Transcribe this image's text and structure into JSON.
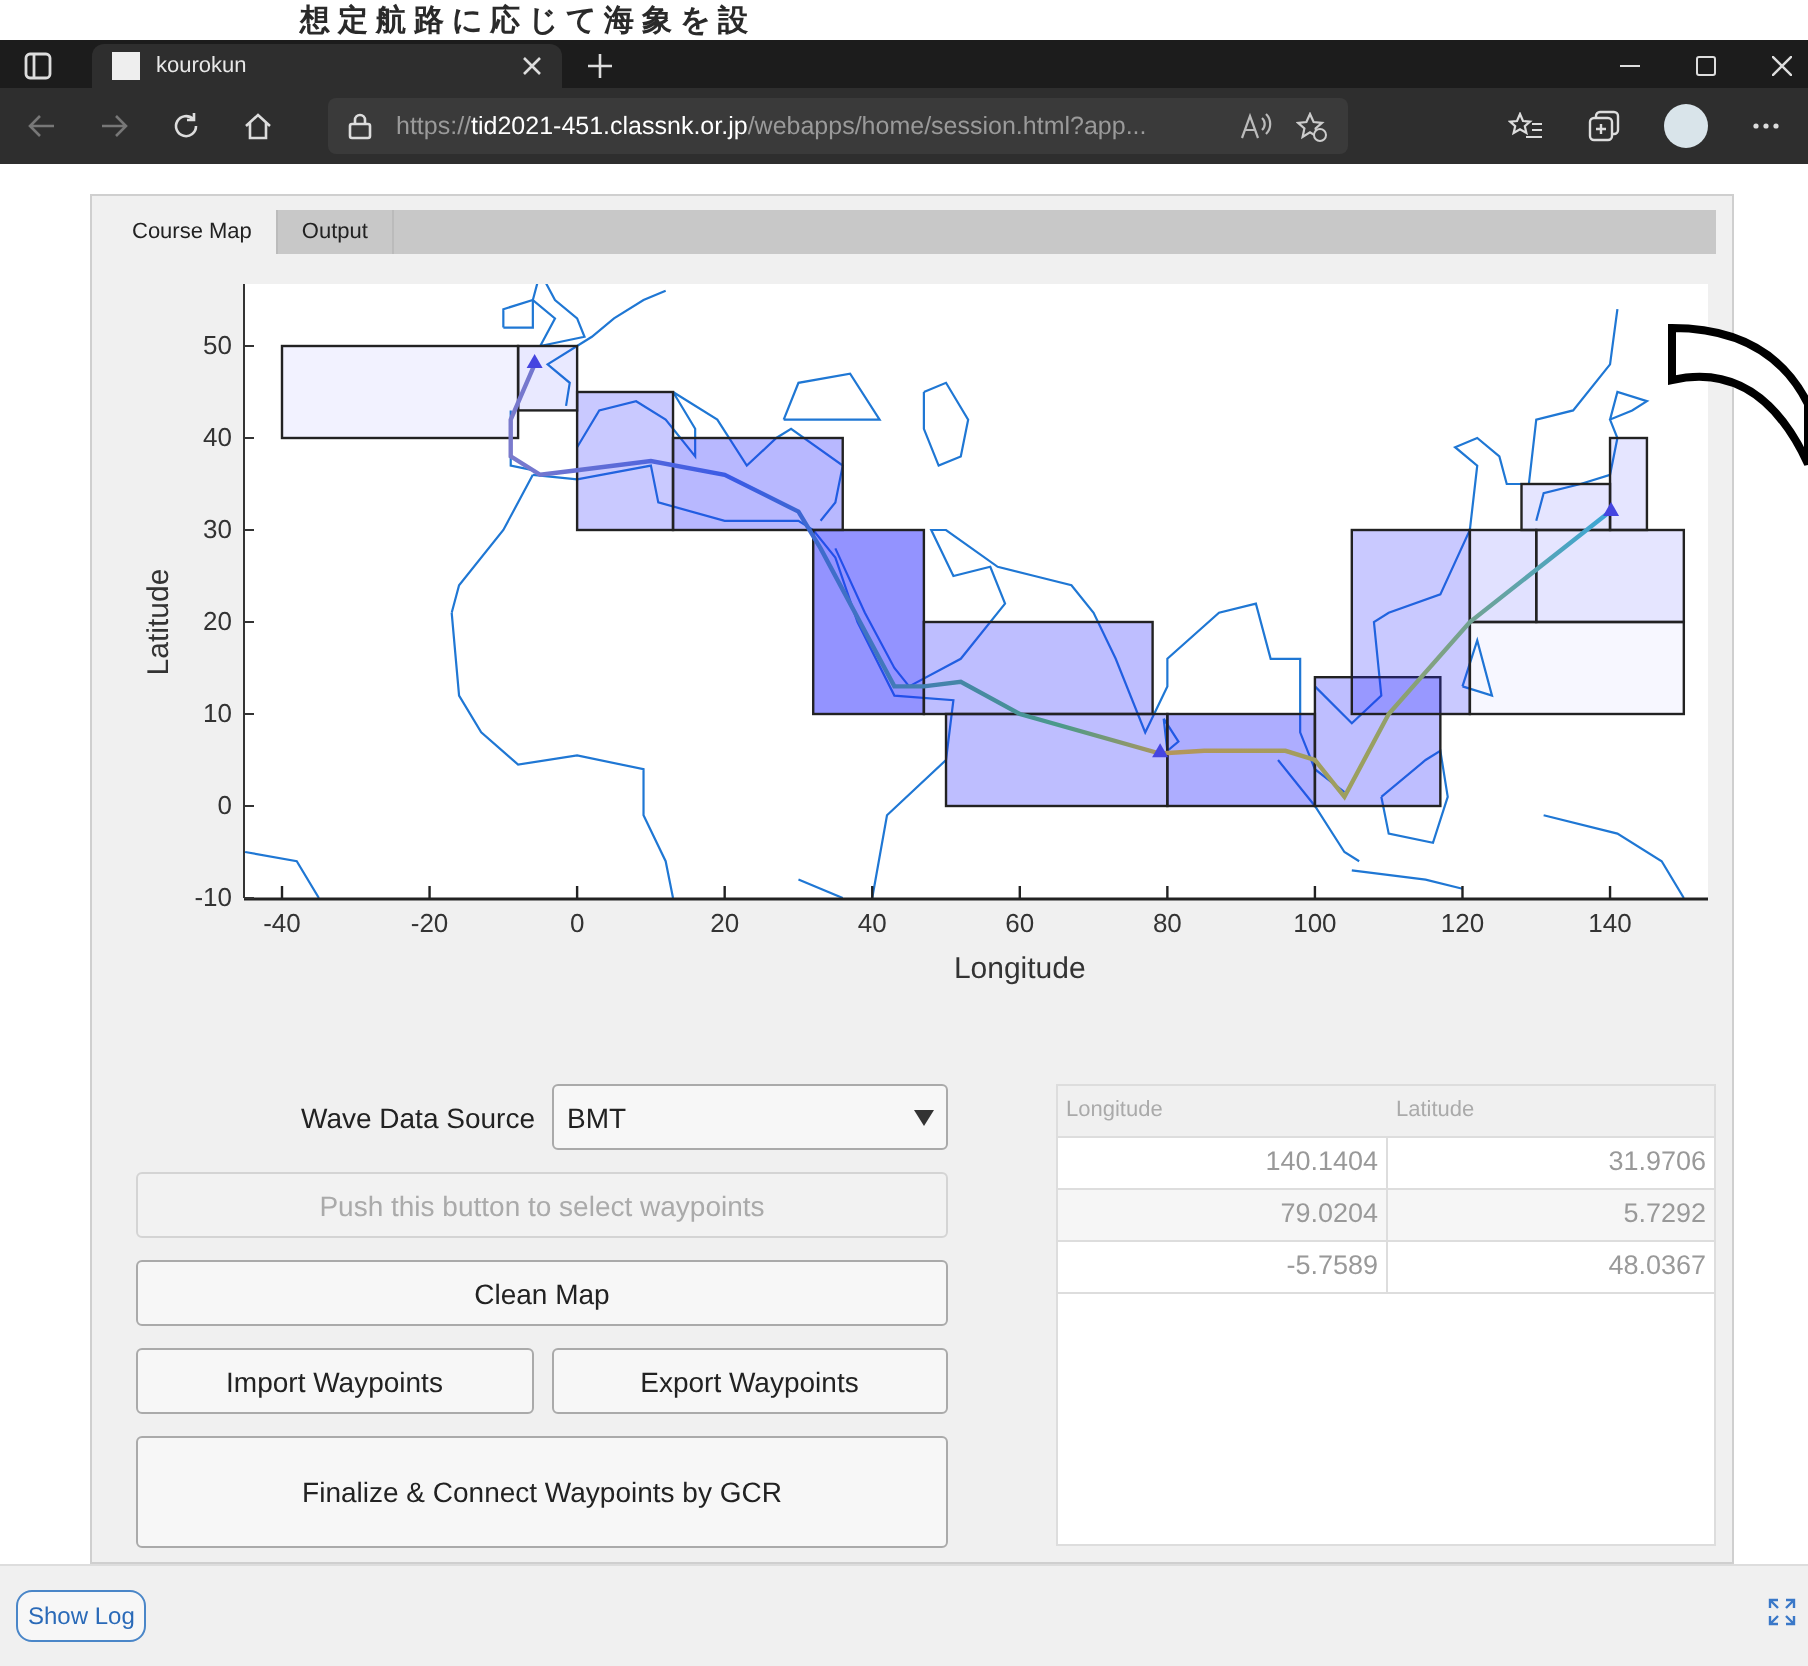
{
  "caption": "想定航路に応じて海象を設",
  "browser": {
    "tab_title": "kourokun",
    "url": {
      "scheme": "https://",
      "host": "tid2021-451.classnk.or.jp",
      "path": "/webapps/home/session.html?app..."
    }
  },
  "app": {
    "tabs": [
      {
        "label": "Course Map",
        "selected": true
      },
      {
        "label": "Output",
        "selected": false
      }
    ],
    "map": {
      "xlabel": "Longitude",
      "ylabel": "Latitude",
      "xticks": [
        "-40",
        "-20",
        "0",
        "20",
        "40",
        "60",
        "80",
        "100",
        "120",
        "140"
      ],
      "yticks": [
        "50",
        "40",
        "30",
        "20",
        "10",
        "0",
        "-10"
      ]
    },
    "wave_source": {
      "label": "Wave Data Source",
      "value": "BMT"
    },
    "buttons": [
      {
        "label": "Push this button to select waypoints",
        "kind": "wide",
        "disabled": true
      },
      {
        "label": "Clean Map",
        "kind": "wide",
        "disabled": false
      },
      {
        "label": "Import Waypoints",
        "kind": "half",
        "disabled": false
      },
      {
        "label": "Export Waypoints",
        "kind": "half",
        "disabled": false
      },
      {
        "label": "Finalize & Connect Waypoints by GCR",
        "kind": "tall",
        "disabled": false
      }
    ],
    "table": {
      "columns": [
        "Longitude",
        "Latitude"
      ],
      "rows": [
        [
          "140.1404",
          "31.9706"
        ],
        [
          "79.0204",
          "5.7292"
        ],
        [
          "-5.7589",
          "48.0367"
        ]
      ]
    }
  },
  "footer": {
    "show_log": "Show Log"
  }
}
